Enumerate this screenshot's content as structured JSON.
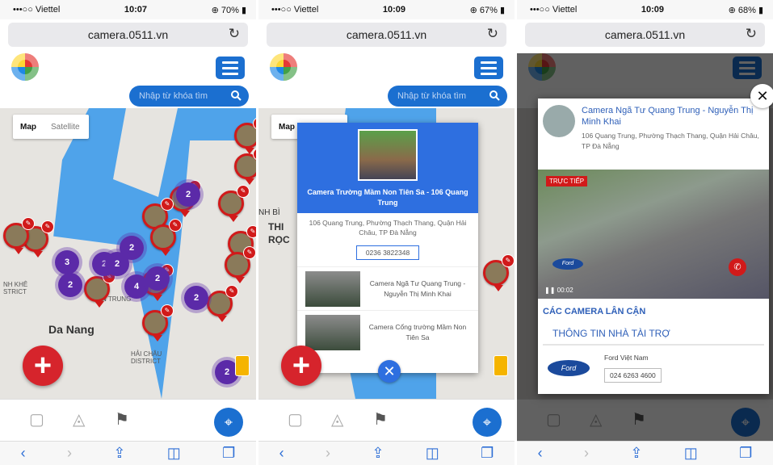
{
  "phones": [
    {
      "carrier": "•••○○ Viettel",
      "time": "10:07",
      "battery": "70%"
    },
    {
      "carrier": "•••○○ Viettel",
      "time": "10:09",
      "battery": "67%"
    },
    {
      "carrier": "•••○○ Viettel",
      "time": "10:09",
      "battery": "68%"
    }
  ],
  "url": "camera.0511.vn",
  "search_placeholder": "Nhập từ khóa tìm",
  "map_toggle": {
    "map": "Map",
    "satellite": "Satellite"
  },
  "map_labels": {
    "da_nang": "Da Nang",
    "an_trung": "N TRUNG",
    "khe": "NH KHÊ\nSTRICT",
    "hai_chau": "HẢI CHÂU\nDISTRICT",
    "thi": "THI",
    "roc": "RỌC",
    "binh": "NH BÌ"
  },
  "clusters_p1": [
    "2",
    "2",
    "3",
    "2",
    "2",
    "2",
    "4",
    "2",
    "2",
    "2"
  ],
  "popup": {
    "title": "Camera Trường Mầm Non Tiên Sa - 106 Quang Trung",
    "address": "106 Quang Trung, Phường Thạch Thang, Quận Hải Châu, TP Đà Nẵng",
    "phone": "0236 3822348",
    "nearby": [
      {
        "label": "Camera Ngã Tư Quang Trung - Nguyễn Thị Minh Khai"
      },
      {
        "label": "Camera Cổng trường Mầm Non Tiên Sa"
      }
    ]
  },
  "modal": {
    "title": "Camera Ngã Tư Quang Trung - Nguyễn Thị Minh Khai",
    "address": "106 Quang Trung, Phường Thạch Thang, Quận Hải Châu, TP Đà Nẵng",
    "live": "TRỰC TIẾP",
    "video_time": "00:02",
    "nearby_heading": "CÁC CAMERA LÂN CẬN",
    "sponsor_heading": "THÔNG TIN NHÀ TÀI TRỢ",
    "sponsor_name": "Ford Việt Nam",
    "sponsor_phone": "024 6263 4600",
    "ford": "Ford"
  },
  "colors": {
    "accent": "#1b6fd0",
    "marker": "#d11a1a",
    "cluster": "#5b2aa8",
    "add": "#d6242c"
  }
}
